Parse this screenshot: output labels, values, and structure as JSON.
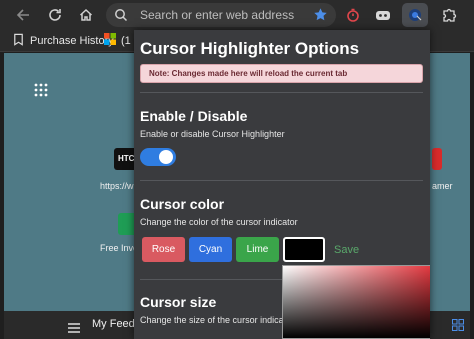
{
  "browser": {
    "address_placeholder": "Search or enter web address",
    "bookmarks": [
      {
        "label": "Purchase History"
      },
      {
        "label": "(1"
      }
    ]
  },
  "page": {
    "captions": [
      "https://w",
      "Free Invo",
      "amer"
    ],
    "tile_texts": [
      "HTC"
    ],
    "my_feed": "My Feed"
  },
  "options": {
    "title": "Cursor Highlighter Options",
    "note": "Note: Changes made here will reload the current tab",
    "enable": {
      "title": "Enable / Disable",
      "description": "Enable or disable Cursor Highlighter",
      "enabled": true
    },
    "color": {
      "title": "Cursor color",
      "description": "Change the color of the cursor indicator",
      "buttons": [
        {
          "label": "Rose",
          "color": "#d95a61"
        },
        {
          "label": "Cyan",
          "color": "#2f6fde"
        },
        {
          "label": "Lime",
          "color": "#3aa54a"
        }
      ],
      "current_color": "#000000",
      "save_label": "Save"
    },
    "size": {
      "title": "Cursor size",
      "description": "Change the size of the cursor indicator"
    }
  }
}
